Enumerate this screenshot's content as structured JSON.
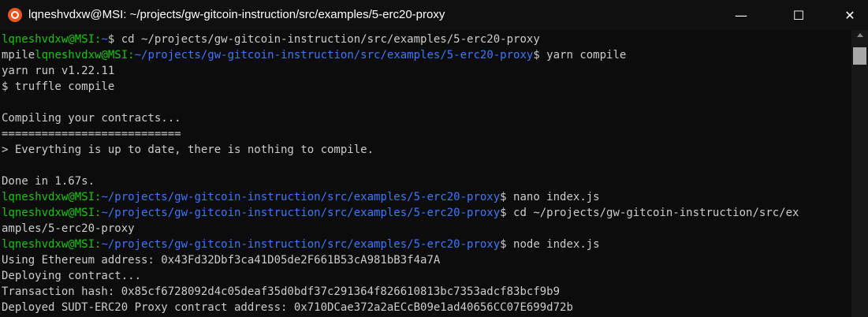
{
  "window": {
    "title": "lqneshvdxw@MSI: ~/projects/gw-gitcoin-instruction/src/examples/5-erc20-proxy",
    "minimize": "—",
    "maximize": "☐",
    "close": "✕"
  },
  "terminal": {
    "lines": [
      [
        {
          "text": "lqneshvdxw@MSI:",
          "c": "g"
        },
        {
          "text": "~",
          "c": "b"
        },
        {
          "text": "$ cd ~/projects/gw-gitcoin-instruction/src/examples/5-erc20-proxy",
          "c": "w"
        }
      ],
      [
        {
          "text": "mpile",
          "c": "w"
        },
        {
          "text": "lqneshvdxw@MSI:",
          "c": "g"
        },
        {
          "text": "~/projects/gw-gitcoin-instruction/src/examples/5-erc20-proxy",
          "c": "b"
        },
        {
          "text": "$ yarn compile",
          "c": "w"
        }
      ],
      [
        {
          "text": "yarn run v1.22.11",
          "c": "w"
        }
      ],
      [
        {
          "text": "$ truffle compile",
          "c": "w"
        }
      ],
      [
        {
          "text": "",
          "c": "w"
        }
      ],
      [
        {
          "text": "Compiling your contracts...",
          "c": "w"
        }
      ],
      [
        {
          "text": "===========================",
          "c": "w"
        }
      ],
      [
        {
          "text": "> Everything is up to date, there is nothing to compile.",
          "c": "w"
        }
      ],
      [
        {
          "text": "",
          "c": "w"
        }
      ],
      [
        {
          "text": "Done in 1.67s.",
          "c": "w"
        }
      ],
      [
        {
          "text": "lqneshvdxw@MSI:",
          "c": "g"
        },
        {
          "text": "~/projects/gw-gitcoin-instruction/src/examples/5-erc20-proxy",
          "c": "b"
        },
        {
          "text": "$ nano index.js",
          "c": "w"
        }
      ],
      [
        {
          "text": "lqneshvdxw@MSI:",
          "c": "g"
        },
        {
          "text": "~/projects/gw-gitcoin-instruction/src/examples/5-erc20-proxy",
          "c": "b"
        },
        {
          "text": "$ cd ~/projects/gw-gitcoin-instruction/src/ex",
          "c": "w"
        }
      ],
      [
        {
          "text": "amples/5-erc20-proxy",
          "c": "w"
        }
      ],
      [
        {
          "text": "lqneshvdxw@MSI:",
          "c": "g"
        },
        {
          "text": "~/projects/gw-gitcoin-instruction/src/examples/5-erc20-proxy",
          "c": "b"
        },
        {
          "text": "$ node index.js",
          "c": "w"
        }
      ],
      [
        {
          "text": "Using Ethereum address: 0x43Fd32Dbf3ca41D05de2F661B53cA981bB3f4a7A",
          "c": "w"
        }
      ],
      [
        {
          "text": "Deploying contract...",
          "c": "w"
        }
      ],
      [
        {
          "text": "Transaction hash: 0x85cf6728092d4c05deaf35d0bdf37c291364f826610813bc7353adcf83bcf9b9",
          "c": "w"
        }
      ],
      [
        {
          "text": "Deployed SUDT-ERC20 Proxy contract address: 0x710DCae372a2aECcB09e1ad40656CC07E699d72b",
          "c": "w"
        }
      ]
    ]
  },
  "colors": {
    "green": "#16c60c",
    "blue": "#3b78ff",
    "text": "#cccccc",
    "background": "#0c0c0c"
  }
}
